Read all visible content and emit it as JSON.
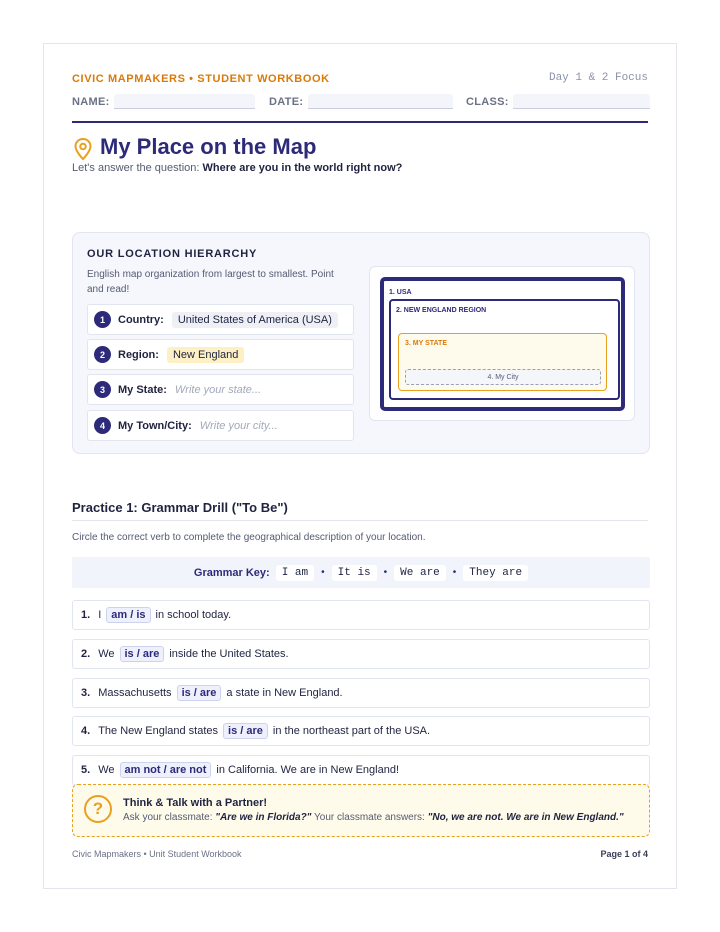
{
  "header": {
    "brand": "CIVIC MAPMAKERS • STUDENT WORKBOOK",
    "focus": "Day 1 & 2 Focus",
    "name_label": "NAME:",
    "date_label": "DATE:",
    "class_label": "CLASS:"
  },
  "title": {
    "icon": "map-pin-icon",
    "text": "My Place on the Map",
    "subtitle_lead": "Let's answer the question:",
    "subtitle_question": "Where are you in the world right now?"
  },
  "hierarchy": {
    "title": "OUR LOCATION HIERARCHY",
    "description": "English map organization from largest to smallest. Point and read!",
    "rows": [
      {
        "num": "1",
        "label": "Country:",
        "value": "United States of America (USA)",
        "placeholder": ""
      },
      {
        "num": "2",
        "label": "Region:",
        "value": "New England",
        "placeholder": ""
      },
      {
        "num": "3",
        "label": "My State:",
        "value": "",
        "placeholder": "Write your state..."
      },
      {
        "num": "4",
        "label": "My Town/City:",
        "value": "",
        "placeholder": "Write your city..."
      }
    ],
    "map": {
      "usa": "1. USA",
      "region": "2. NEW ENGLAND REGION",
      "state": "3. MY STATE",
      "city": "4. My City"
    }
  },
  "practice": {
    "title": "Practice 1: Grammar Drill (\"To Be\")",
    "description": "Circle the correct verb to complete the geographical description of your location.",
    "key_label": "Grammar Key:",
    "key_items": [
      "I am",
      "It is",
      "We are",
      "They are"
    ],
    "questions": [
      {
        "num": "1.",
        "before": "I",
        "options": "am / is",
        "after": "in school today."
      },
      {
        "num": "2.",
        "before": "We",
        "options": "is / are",
        "after": "inside the United States."
      },
      {
        "num": "3.",
        "before": "Massachusetts",
        "options": "is / are",
        "after": "a state in New England."
      },
      {
        "num": "4.",
        "before": "The New England states",
        "options": "is / are",
        "after": "in the northeast part of the USA."
      },
      {
        "num": "5.",
        "before": "We",
        "options": "am not / are not",
        "after": "in California. We are in New England!"
      }
    ]
  },
  "talk": {
    "icon": "question-icon",
    "title": "Think & Talk with a Partner!",
    "ask_lead": "Ask your classmate:",
    "ask_quote": "\"Are we in Florida?\"",
    "answer_lead": "Your classmate answers:",
    "answer_quote": "\"No, we are not. We are in New England.\""
  },
  "footer": {
    "left": "Civic Mapmakers • Unit Student Workbook",
    "right": "Page 1 of 4"
  },
  "colors": {
    "brand_orange": "#d97a0a",
    "navy": "#2e2a7a",
    "yellow": "#e8a020"
  }
}
